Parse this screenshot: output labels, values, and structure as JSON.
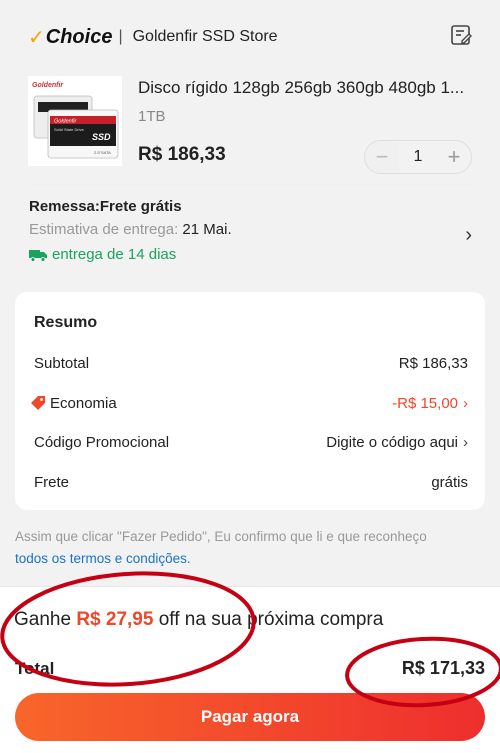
{
  "store": {
    "brand": "Choice",
    "separator": "|",
    "name": "Goldenfir SSD Store",
    "edit_icon": "edit-note-icon"
  },
  "product": {
    "title": "Disco rígido 128gb 256gb 360gb 480gb 1...",
    "variant": "1TB",
    "price": "R$ 186,33",
    "quantity": "1",
    "image_brand": "Goldenfir",
    "image_caption": "Solid State Drive",
    "image_label": "SSD",
    "image_size": "2.5\"SATA"
  },
  "shipping": {
    "title": "Remessa:Frete grátis",
    "estimate_label": "Estimativa de entrega:",
    "estimate_date": "21 Mai.",
    "fast_label": "entrega de 14 dias"
  },
  "summary": {
    "title": "Resumo",
    "subtotal_label": "Subtotal",
    "subtotal_value": "R$ 186,33",
    "savings_label": "Economia",
    "savings_value": "-R$ 15,00",
    "promo_label": "Código Promocional",
    "promo_value": "Digite o código aqui",
    "shipping_label": "Frete",
    "shipping_value": "grátis"
  },
  "terms": {
    "text": "Assim que clicar \"Fazer Pedido\", Eu confirmo que li e que reconheço",
    "link": "todos os termos e condições."
  },
  "bottom": {
    "promo_prefix": "Ganhe",
    "promo_amount": "R$ 27,95",
    "promo_suffix": "off na sua próxima compra",
    "total_label": "Total",
    "total_value": "R$ 171,33",
    "pay_button": "Pagar agora"
  },
  "colors": {
    "accent_red": "#f0462a",
    "green": "#1aa260",
    "link_blue": "#1a73c9",
    "annotation_red": "#c40012"
  }
}
